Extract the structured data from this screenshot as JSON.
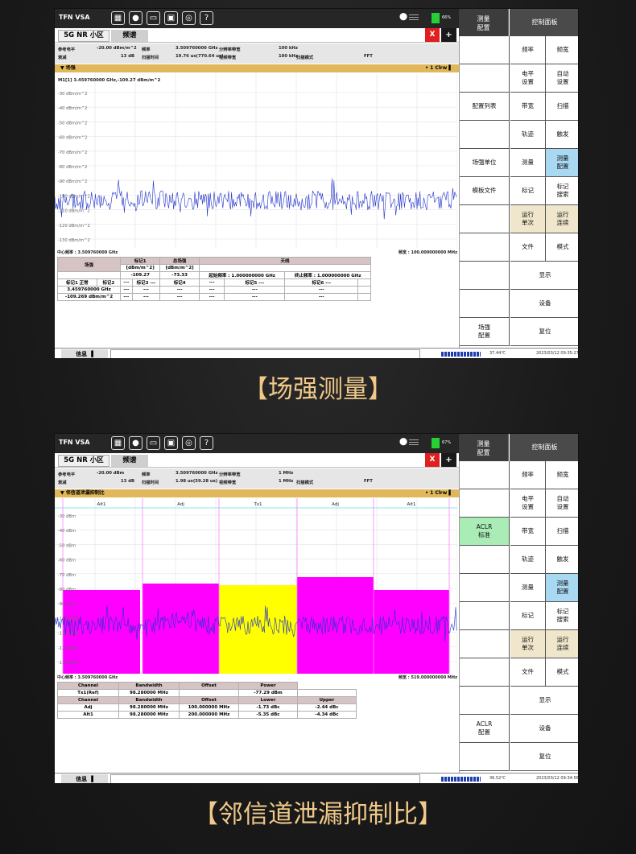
{
  "captions": [
    "【场强测量】",
    "【邻信道泄漏抑制比】"
  ],
  "app": {
    "name": "TFN VSA",
    "icons": [
      "window-icon",
      "lightbulb-icon",
      "folder-icon",
      "save-icon",
      "camera-icon",
      "help-icon"
    ]
  },
  "screens": [
    {
      "battery": "66%",
      "rtop_left": "测量\n配置",
      "rtop_right": "控制面板",
      "tab_a": "5G NR 小区",
      "tab_b": "频谱",
      "close": "X",
      "add": "+",
      "params": [
        [
          "参考电平",
          "-20.00 dBm/m^2"
        ],
        [
          "频率",
          "3.509760000 GHz"
        ],
        [
          "分辨率带宽",
          "100 kHz"
        ],
        [
          "衰减",
          "13 dB"
        ],
        [
          "扫描时间",
          "19.76 us(770.64 us)"
        ],
        [
          "视频带宽",
          "100 kHz"
        ],
        [
          "扫描模式",
          "FFT"
        ]
      ],
      "title": "▼ 场强",
      "trace": "1 Clrw",
      "marker": "M1[1]    3.459760000 GHz,-109.27 dBm/m^2",
      "yticks": [
        "-30 dBm/m^2",
        "-40 dBm/m^2",
        "-50 dBm/m^2",
        "-60 dBm/m^2",
        "-70 dBm/m^2",
        "-80 dBm/m^2",
        "-90 dBm/m^2",
        "-100 dBm/m^2",
        "-110 dBm/m^2",
        "-120 dBm/m^2",
        "-130 dBm/m^2"
      ],
      "center": "中心频率 : 3.509760000 GHz",
      "span": "频宽 : 100.000000000 MHz",
      "side": [
        "",
        "",
        "配置列表",
        "",
        "场强单位",
        "模板文件",
        "",
        "",
        "",
        "",
        "场强\n配置"
      ],
      "results": {
        "h1": "场强",
        "h2": "标记1",
        "h2u": "[dBm/m^2]",
        "h3": "总场强",
        "h3u": "[dBm/m^2]",
        "h4": "天线",
        "v1": "-109.27",
        "v2": "-73.33",
        "start": "起始频率 : 1.000000000 GHz",
        "stop": "终止频率 : 1.000000000 GHz",
        "m1": "标记1",
        "m1s": "正常",
        "m1f": "3.459760000 GHz",
        "m1v": "-109.269 dBm/m^2",
        "marks": [
          "标记2",
          "标记3",
          "标记4",
          "标记5",
          "标记6"
        ],
        "dash": "---"
      },
      "temp": "37.44℃",
      "date": "2023/03/12 09:35:27"
    },
    {
      "battery": "67%",
      "rtop_left": "测量\n配置",
      "rtop_right": "控制面板",
      "tab_a": "5G NR 小区",
      "tab_b": "频谱",
      "close": "X",
      "add": "+",
      "params": [
        [
          "参考电平",
          "-20.00 dBm"
        ],
        [
          "频率",
          "3.509760000 GHz"
        ],
        [
          "分辨率带宽",
          "1 MHz"
        ],
        [
          "衰减",
          "13 dB"
        ],
        [
          "扫描时间",
          "1.98 us(59.28 us)"
        ],
        [
          "视频带宽",
          "1 MHz"
        ],
        [
          "扫描模式",
          "FFT"
        ]
      ],
      "title": "▼ 邻信道泄漏抑制比",
      "trace": "1 Clrw",
      "yticks": [
        "-30 dBm",
        "-40 dBm",
        "-50 dBm",
        "-60 dBm",
        "-70 dBm",
        "-80 dBm",
        "-90 dBm",
        "-100 dBm",
        "-110 dBm",
        "-120 dBm",
        "-130 dBm"
      ],
      "channels": [
        "Alt1",
        "Adj",
        "Tx1",
        "Adj",
        "Alt1"
      ],
      "center": "中心频率 : 3.509760000 GHz",
      "span": "频宽 : 519.000000000 MHz",
      "side": [
        "",
        "",
        "ACLR\n标准",
        "",
        "",
        "",
        "",
        "",
        "",
        "ACLR\n配置",
        ""
      ],
      "aclr": {
        "h": [
          "Channel",
          "Bandwidth",
          "Offset",
          "Power"
        ],
        "tx": [
          "Tx1(Ref)",
          "98.280000 MHz",
          "",
          "-77.29 dBm"
        ],
        "h2": [
          "Channel",
          "Bandwidth",
          "Offset",
          "Lower",
          "Upper"
        ],
        "rows": [
          [
            "Adj",
            "98.280000 MHz",
            "100.000000 MHz",
            "-1.73 dBc",
            "-2.44 dBc"
          ],
          [
            "Alt1",
            "98.280000 MHz",
            "200.000000 MHz",
            "-5.35 dBc",
            "-4.34 dBc"
          ]
        ]
      },
      "temp": "36.52℃",
      "date": "2023/03/12 09:34:56"
    }
  ],
  "panel": {
    "r1": [
      "频率",
      "频宽"
    ],
    "r2": [
      "电平\n设置",
      "自动\n设置"
    ],
    "r3": [
      "带宽",
      "扫描"
    ],
    "r4": [
      "轨迹",
      "触发"
    ],
    "r5": [
      "测量",
      "测量\n配置"
    ],
    "r6": [
      "标记",
      "标记\n搜索"
    ],
    "r7": [
      "运行\n单次",
      "运行\n连续"
    ],
    "r8": [
      "文件",
      "模式"
    ],
    "display": "显示",
    "device": "设备",
    "reset": "复位"
  },
  "status": {
    "info": "信息"
  },
  "colors": {
    "accent": "#e0b75a",
    "trace": "#2233cc",
    "highlight": "#a9d8f2",
    "adj": "#ff00ff",
    "tx": "#ffff00"
  }
}
